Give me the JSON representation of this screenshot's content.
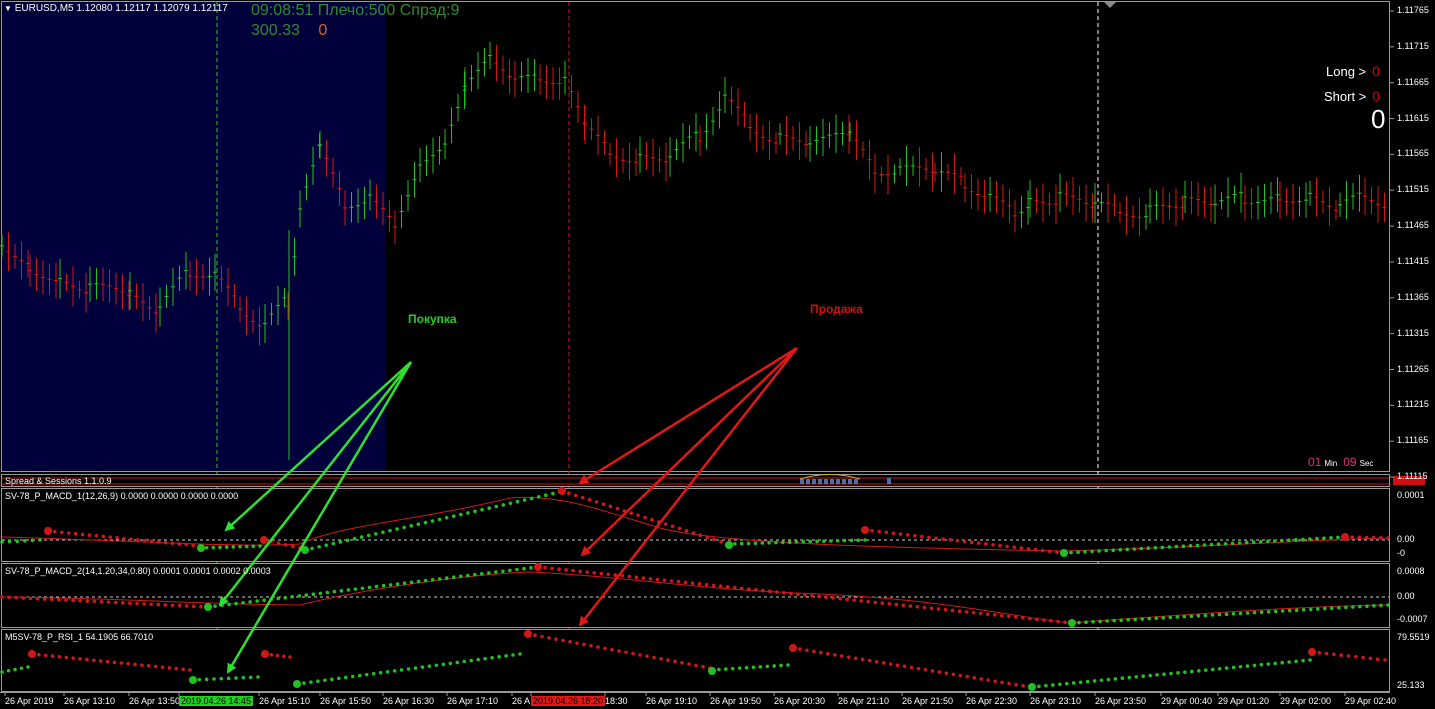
{
  "chart": {
    "header": "EURUSD,M5  1.12080 1.12117 1.12079 1.12117",
    "timer_text": "09:08:51 Плечо:500 Спрэд:9",
    "balance": "300.33",
    "profit": "0",
    "long_label": "Long >",
    "long_count": "0",
    "short_label": "Short >",
    "short_count": "0",
    "total_count": "0",
    "buy_annotation": "Покупка",
    "sell_annotation": "Продажа",
    "countdown": {
      "min": "01",
      "min_unit": "Min",
      "sec": "09",
      "sec_unit": "Sec"
    },
    "price_axis": [
      "1.11765",
      "1.11715",
      "1.11665",
      "1.11615",
      "1.11565",
      "1.11515",
      "1.11465",
      "1.11415",
      "1.11365",
      "1.11315",
      "1.11265",
      "1.11215",
      "1.11165",
      "1.11115"
    ],
    "time_axis": [
      "26 Apr 2019",
      "26 Apr 13:10",
      "26 Apr 13:50",
      "2019.04.26 14:45",
      "26 Apr 15:10",
      "26 Apr 15:50",
      "26 Apr 16:30",
      "26 Apr 17:10",
      "26 A",
      "2019.04.26 18:20",
      "18:30",
      "26 Apr 19:10",
      "26 Apr 19:50",
      "26 Apr 20:30",
      "26 Apr 21:10",
      "26 Apr 21:50",
      "26 Apr 22:30",
      "26 Apr 23:10",
      "26 Apr 23:50",
      "29 Apr 00:40",
      "29 Apr 01:20",
      "29 Apr 02:00",
      "29 Apr 02:40"
    ],
    "time_highlight_buy": "2019.04.26 14:45",
    "time_highlight_sell": "2019.04.26 18:20"
  },
  "panels": {
    "spread": {
      "label": "Spread & Sessions 1.1.0.9"
    },
    "macd1": {
      "label": "SV-78_P_MACD_1(12,26,9) 0.0000 0.0000 0.0000 0.0000",
      "axis": [
        "0.0001",
        "0.00",
        "-0"
      ]
    },
    "macd2": {
      "label": "SV-78_P_MACD_2(14,1.20,34,0.80) 0.0001 0.0001 0.0002 0.0003",
      "axis": [
        "0.0008",
        "0.00",
        "-0.0007"
      ]
    },
    "rsi": {
      "label": "M5SV-78_P_RSI_1 54.1905 66.7010",
      "axis": [
        "79.5519",
        "25.133"
      ]
    }
  },
  "colors": {
    "bull": "#22c022",
    "bear": "#d01818",
    "session": "#00003a",
    "buy_arrow": "#30e030",
    "sell_arrow": "#e01818"
  }
}
